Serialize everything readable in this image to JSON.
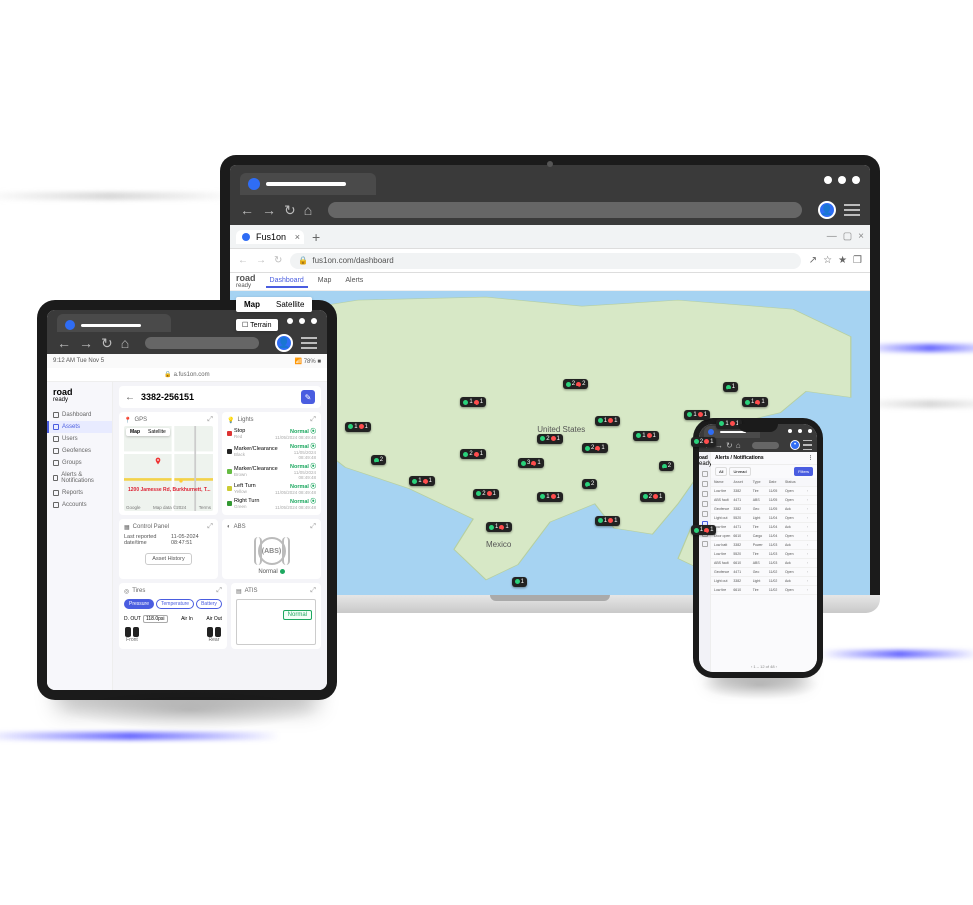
{
  "os_chrome": {
    "browser_tab_title": "Fus1on",
    "new_tab": "+",
    "addr_url": "fus1on.com/dashboard",
    "lock_icon": "🔒",
    "back": "←",
    "fwd": "→",
    "reload": "↻",
    "home": "⌂",
    "share": "↗",
    "star": "☆",
    "ext": "★",
    "puzzle": "❐",
    "min": "—",
    "max": "▢",
    "close": "×"
  },
  "laptop_app": {
    "brand_top": "road",
    "brand_bottom": "ready",
    "tab_dashboard": "Dashboard",
    "tab_map": "Map",
    "tab_alerts": "Alerts",
    "map_btn_map": "Map",
    "map_btn_sat": "Satellite",
    "map_terrain": "☐ Terrain",
    "country1": "United States",
    "country2": "Mexico",
    "markers": [
      {
        "x": 52,
        "y": 29,
        "g": 2,
        "r": 2
      },
      {
        "x": 36,
        "y": 35,
        "g": 1,
        "r": 1
      },
      {
        "x": 18,
        "y": 43,
        "g": 1,
        "r": 1
      },
      {
        "x": 22,
        "y": 54,
        "g": 2,
        "r": 0
      },
      {
        "x": 28,
        "y": 61,
        "g": 1,
        "r": 1
      },
      {
        "x": 36,
        "y": 52,
        "g": 2,
        "r": 1
      },
      {
        "x": 38,
        "y": 65,
        "g": 2,
        "r": 1
      },
      {
        "x": 40,
        "y": 76,
        "g": 1,
        "r": 1
      },
      {
        "x": 45,
        "y": 55,
        "g": 3,
        "r": 1
      },
      {
        "x": 48,
        "y": 47,
        "g": 2,
        "r": 1
      },
      {
        "x": 48,
        "y": 66,
        "g": 1,
        "r": 1
      },
      {
        "x": 55,
        "y": 50,
        "g": 2,
        "r": 1
      },
      {
        "x": 55,
        "y": 62,
        "g": 2,
        "r": 0
      },
      {
        "x": 57,
        "y": 41,
        "g": 1,
        "r": 1
      },
      {
        "x": 57,
        "y": 74,
        "g": 1,
        "r": 1
      },
      {
        "x": 63,
        "y": 46,
        "g": 1,
        "r": 1
      },
      {
        "x": 64,
        "y": 66,
        "g": 2,
        "r": 1
      },
      {
        "x": 67,
        "y": 56,
        "g": 2,
        "r": 0
      },
      {
        "x": 71,
        "y": 39,
        "g": 1,
        "r": 1
      },
      {
        "x": 72,
        "y": 48,
        "g": 2,
        "r": 1
      },
      {
        "x": 72,
        "y": 77,
        "g": 1,
        "r": 1
      },
      {
        "x": 76,
        "y": 42,
        "g": 1,
        "r": 1
      },
      {
        "x": 80,
        "y": 35,
        "g": 1,
        "r": 1
      },
      {
        "x": 77,
        "y": 30,
        "g": 1,
        "r": 0
      },
      {
        "x": 44,
        "y": 94,
        "g": 1,
        "r": 0
      }
    ]
  },
  "tablet_status": {
    "time": "9:12 AM  Tue Nov 5",
    "wifi": "📶 78% ■",
    "mini_url_lock": "🔒",
    "mini_url": "a.fus1on.com"
  },
  "sidebar": {
    "items": [
      {
        "label": "Dashboard"
      },
      {
        "label": "Assets"
      },
      {
        "label": "Users"
      },
      {
        "label": "Geofences"
      },
      {
        "label": "Groups"
      },
      {
        "label": "Alerts & Notifications"
      },
      {
        "label": "Reports"
      },
      {
        "label": "Accounts"
      }
    ]
  },
  "asset": {
    "back": "←",
    "id": "3382-256151",
    "action_icon": "✎"
  },
  "gps": {
    "title": "GPS",
    "icon": "📍",
    "map_btn": "Map",
    "sat_btn": "Satellite",
    "address": "1200 Jamesse Rd, Burkhurnett, T...",
    "corner_logo": "Google",
    "footer_left": "Map data ©2024",
    "footer_right": "Terms"
  },
  "lights": {
    "title": "Lights",
    "icon": "💡",
    "rows": [
      {
        "sw": "#d33",
        "name": "Stop",
        "sub": "Red",
        "status": "Normal ⦿",
        "ts": "11/05/2024 08:49:48"
      },
      {
        "sw": "#222",
        "name": "Marker/Clearance",
        "sub": "Black",
        "status": "Normal ⦿",
        "ts": "11/05/2024 08:49:48"
      },
      {
        "sw": "#6b4",
        "name": "Marker/Clearance",
        "sub": "Brown",
        "status": "Normal ⦿",
        "ts": "11/05/2024 08:49:48"
      },
      {
        "sw": "#cc3",
        "name": "Left Turn",
        "sub": "Yellow",
        "status": "Normal ⦿",
        "ts": "11/05/2024 08:49:48"
      },
      {
        "sw": "#393",
        "name": "Right Turn",
        "sub": "Green",
        "status": "Normal ⦿",
        "ts": "11/05/2024 08:49:48"
      }
    ]
  },
  "control_panel": {
    "title": "Control Panel",
    "icon": "▦",
    "rows": [
      {
        "k": "Last reported date/time",
        "v": "11-05-2024 08:47:51"
      }
    ],
    "button": "Asset History"
  },
  "abs": {
    "title": "ABS",
    "icon": "◐",
    "badge": "(ABS)",
    "status": "Normal"
  },
  "tires": {
    "title": "Tires",
    "icon": "◎",
    "pill_pressure": "Pressure",
    "pill_temp": "Temperature",
    "pill_battery": "Battery",
    "dout_label": "D. OUT",
    "dout_val": "118.0psi",
    "air_in": "Air In",
    "air_out": "Air Out",
    "front": "Front",
    "rear": "Rear"
  },
  "atis": {
    "title": "ATIS",
    "icon": "▤",
    "status": "Normal"
  },
  "phone": {
    "brand_top": "road",
    "brand_bottom": "ready",
    "page_title": "Alerts / Notifications",
    "filter_all": "All",
    "filter_unread": "Unread",
    "filter_btn": "Filters",
    "cols": [
      "Name",
      "Asset",
      "Type",
      "Date",
      "Status",
      ""
    ],
    "rows": [
      [
        "Low tire",
        "3382",
        "Tire",
        "11/05",
        "Open",
        "›"
      ],
      [
        "ABS fault",
        "4471",
        "ABS",
        "11/05",
        "Open",
        "›"
      ],
      [
        "Geofence",
        "3382",
        "Geo",
        "11/05",
        "Ack",
        "›"
      ],
      [
        "Light out",
        "5520",
        "Light",
        "11/04",
        "Open",
        "›"
      ],
      [
        "Low tire",
        "4471",
        "Tire",
        "11/04",
        "Ack",
        "›"
      ],
      [
        "Door open",
        "6610",
        "Cargo",
        "11/04",
        "Open",
        "›"
      ],
      [
        "Low batt",
        "3382",
        "Power",
        "11/03",
        "Ack",
        "›"
      ],
      [
        "Low tire",
        "5520",
        "Tire",
        "11/03",
        "Open",
        "›"
      ],
      [
        "ABS fault",
        "6610",
        "ABS",
        "11/03",
        "Ack",
        "›"
      ],
      [
        "Geofence",
        "4471",
        "Geo",
        "11/02",
        "Open",
        "›"
      ],
      [
        "Light out",
        "3382",
        "Light",
        "11/02",
        "Ack",
        "›"
      ],
      [
        "Low tire",
        "6610",
        "Tire",
        "11/02",
        "Open",
        "›"
      ]
    ],
    "pager": "‹  1 – 12 of 48  ›"
  }
}
